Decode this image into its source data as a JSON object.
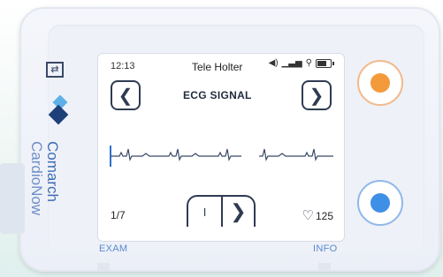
{
  "status": {
    "time": "12:13",
    "title": "Tele Holter"
  },
  "screen": {
    "title": "ECG SIGNAL",
    "page": "1/7",
    "heart_rate": "125"
  },
  "labels": {
    "exam": "EXAM",
    "info": "INFO"
  },
  "brand": {
    "line1": "Comarch",
    "line2": "CardioNow"
  },
  "icons": {
    "prev": "chevron-left-icon",
    "next": "chevron-right-icon",
    "pause": "pause-icon",
    "page_next": "chevron-right-icon",
    "heart": "heart-icon",
    "volume": "speaker-icon",
    "signal": "signal-icon",
    "location": "location-icon",
    "battery": "battery-icon",
    "usb": "usb-icon"
  },
  "colors": {
    "orange_button": "#f39a3a",
    "blue_button": "#3e8fe6",
    "accent": "#3e6db0"
  }
}
